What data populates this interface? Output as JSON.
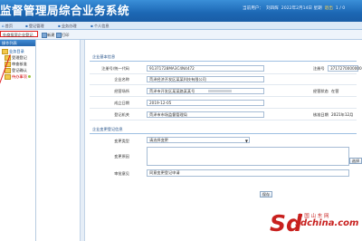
{
  "header": {
    "title": "监督管理局综合业务系统",
    "info_items": [
      "当前用户：",
      "刘四辉",
      "2022年2月14日 星期",
      "1 / 0"
    ],
    "logout": "退出"
  },
  "nav": {
    "items": [
      "首页",
      "登记管理",
      "业务办理",
      "个人信息"
    ]
  },
  "tabbar": {
    "active_tab": "外商投资企业登记",
    "tools": [
      "新建",
      "打印"
    ]
  },
  "sidebar": {
    "header": "操作列表",
    "root": "业务目录",
    "items": [
      "受理登记",
      "审查核准",
      "登记确认",
      "待办事项"
    ],
    "selected_index": 3
  },
  "section1": {
    "title": "企业基本信息",
    "rows": [
      {
        "label": "注册号/统一代码",
        "value": "91371728MA3C4N4472",
        "right_label": "注册号",
        "right_value": "37172700000000000"
      },
      {
        "label": "企业名称",
        "value": "菏泽经济开发区某某科技有限公司",
        "right_label": "",
        "right_value": ""
      },
      {
        "label": "经营场所",
        "value": "菏泽市开发区某某路某某号",
        "right_label": "经营状态",
        "right_value": "在营"
      },
      {
        "label": "成立日期",
        "value": "2019-12-05",
        "right_label": "",
        "right_value": ""
      },
      {
        "label": "登记机关",
        "value": "菏泽市市场监督管理局",
        "right_label": "核准日期",
        "right_value": "2021年12月"
      }
    ]
  },
  "section2": {
    "title": "企业变更登记信息",
    "type_label": "变更类型",
    "type_value": "请选择变更",
    "reason_label": "变更原因",
    "reason_value": "",
    "side_button": "选择",
    "note_label": "审批意见",
    "note_value": "同意变更登记申请"
  },
  "submit_button": "保存",
  "watermark": {
    "logo": "Sd",
    "cn": "中 国 山 东 网",
    "en": "sdchina.com"
  }
}
